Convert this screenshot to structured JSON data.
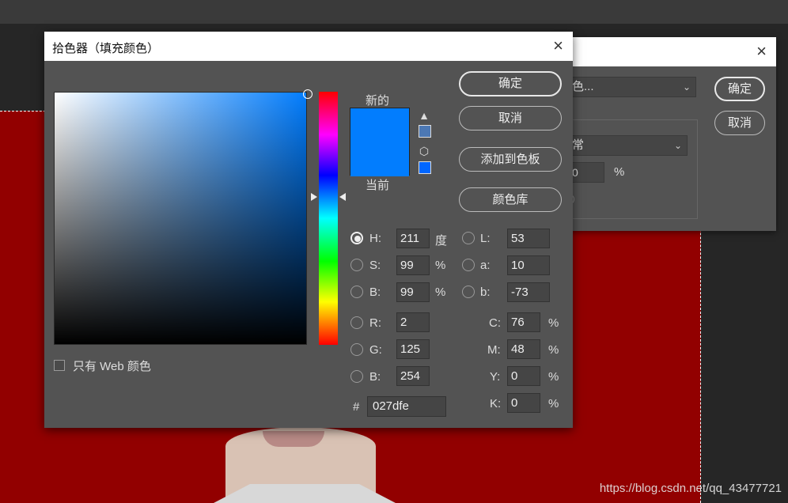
{
  "background": {
    "watermark": "https://blog.csdn.net/qq_43477721"
  },
  "dialog2": {
    "select_value": "色...",
    "mode_value": "常",
    "opacity_value": "0",
    "opacity_unit": "%",
    "ok_label": "确定",
    "cancel_label": "取消",
    "close_icon": "×"
  },
  "picker": {
    "title": "拾色器（填充颜色）",
    "close_icon": "×",
    "new_label": "新的",
    "current_label": "当前",
    "new_color": "#027dfe",
    "current_color": "#027dfe",
    "warning_icon": "▲",
    "cube_icon": "⬡",
    "gamut_swatch_color": "#4c78b4",
    "web_swatch_color": "#0066ff",
    "buttons": {
      "ok": "确定",
      "cancel": "取消",
      "add_swatch": "添加到色板",
      "color_library": "颜色库"
    },
    "hsb": {
      "h_label": "H:",
      "h_value": "211",
      "h_unit": "度",
      "s_label": "S:",
      "s_value": "99",
      "s_unit": "%",
      "b_label": "B:",
      "b_value": "99",
      "b_unit": "%"
    },
    "lab": {
      "l_label": "L:",
      "l_value": "53",
      "a_label": "a:",
      "a_value": "10",
      "b_label": "b:",
      "b_value": "-73"
    },
    "rgb": {
      "r_label": "R:",
      "r_value": "2",
      "g_label": "G:",
      "g_value": "125",
      "b_label": "B:",
      "b_value": "254"
    },
    "cmyk": {
      "c_label": "C:",
      "c_value": "76",
      "c_unit": "%",
      "m_label": "M:",
      "m_value": "48",
      "m_unit": "%",
      "y_label": "Y:",
      "y_value": "0",
      "y_unit": "%",
      "k_label": "K:",
      "k_value": "0",
      "k_unit": "%"
    },
    "web_only_label": "只有 Web 颜色",
    "hash_label": "#",
    "hex_value": "027dfe"
  }
}
